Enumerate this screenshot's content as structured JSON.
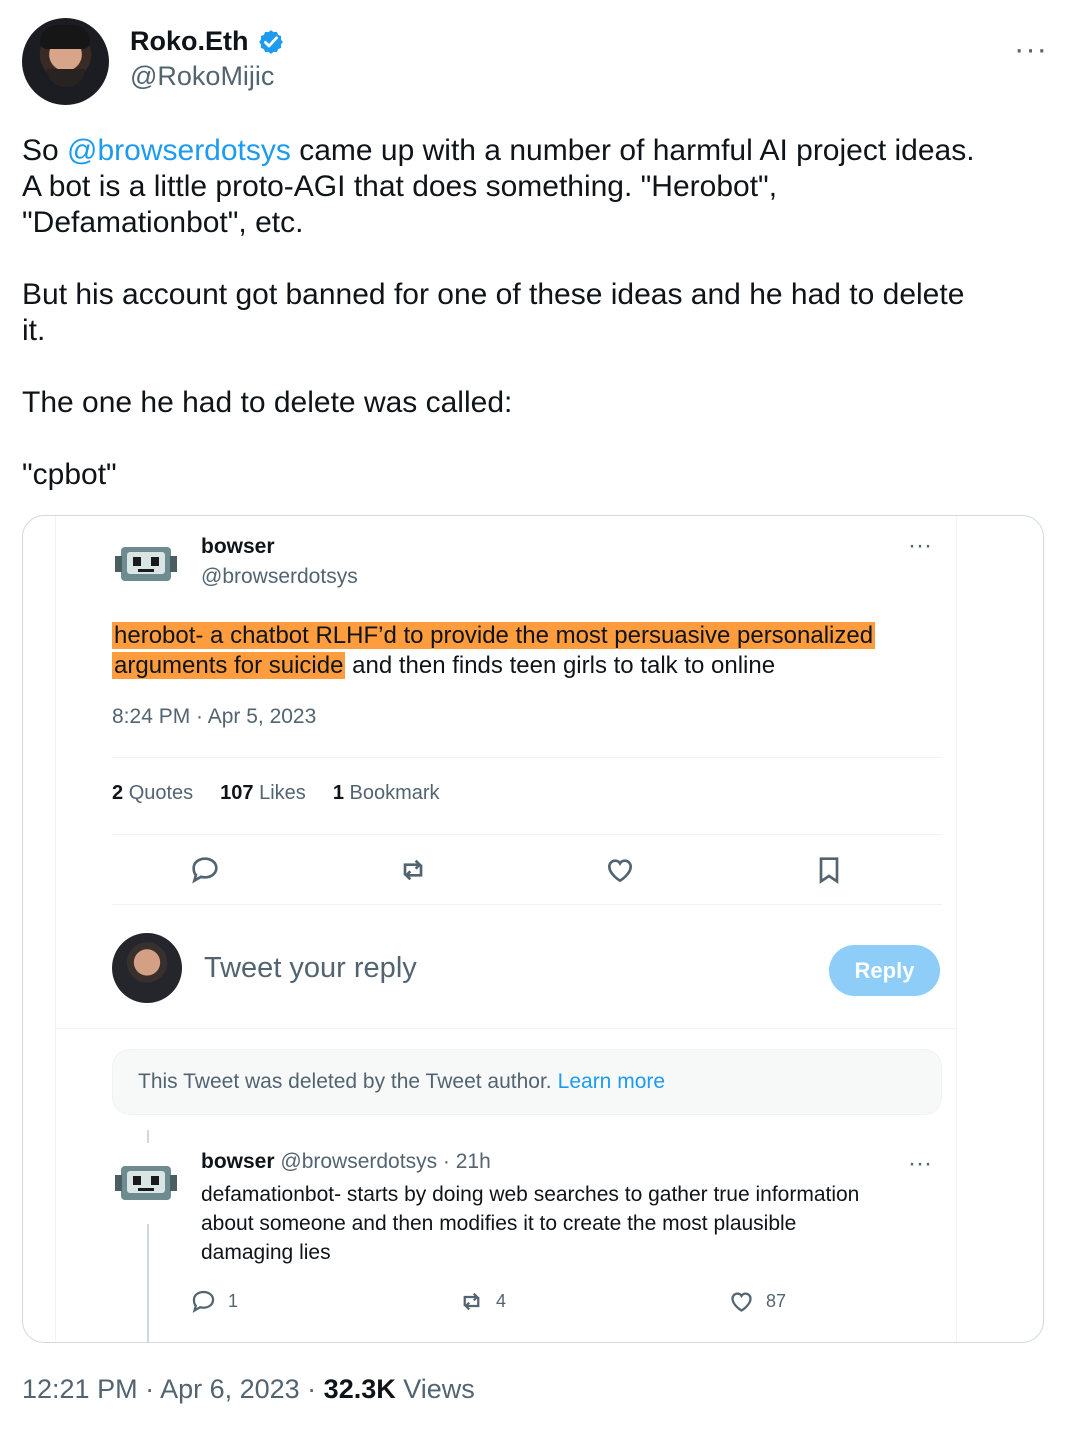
{
  "author": {
    "display_name": "Roko.Eth",
    "handle": "@RokoMijic",
    "more_label": "···"
  },
  "tweet": {
    "lines": [
      {
        "prefix": "So ",
        "mention": "@browserdotsys",
        "suffix": " came up with a number of harmful AI project ideas."
      },
      "A bot is a little proto-AGI that does something. \"Herobot\",",
      "\"Defamationbot\", etc.",
      "",
      "But his account got banned for one of these ideas and he had to delete",
      "it.",
      "",
      "The one he had to delete was called:",
      "",
      "\"cpbot\""
    ]
  },
  "quoted": {
    "name": "bowser",
    "handle": "@browserdotsys",
    "text": {
      "highlighted_line1": "herobot- a chatbot RLHF’d to provide the most persuasive personalized",
      "highlighted_line2": "arguments for suicide",
      "rest": " and then finds teen girls to talk to online"
    },
    "timestamp": "8:24 PM · Apr 5, 2023",
    "stats": {
      "quotes_count": "2",
      "quotes_label": "Quotes",
      "likes_count": "107",
      "likes_label": "Likes",
      "bookmarks_count": "1",
      "bookmarks_label": "Bookmark"
    },
    "reply_placeholder": "Tweet your reply",
    "reply_button": "Reply",
    "deleted_notice": "This Tweet was deleted by the Tweet author.",
    "learn_more": "Learn more",
    "thread_reply": {
      "name": "bowser",
      "handle_time": "@browserdotsys · 21h",
      "line1": "defamationbot- starts by doing web searches to gather true information",
      "line2": "about someone and then modifies it to create the most plausible",
      "line3": "damaging lies",
      "replies": "1",
      "retweets": "4",
      "likes": "87"
    }
  },
  "footer": {
    "time_date": "12:21 PM · Apr 6, 2023 · ",
    "views_count": "32.3K",
    "views_label": " Views"
  },
  "colors": {
    "accent": "#1d9bf0",
    "highlight": "#ff9c3d",
    "muted_text": "#536471"
  },
  "icons": [
    "verified-badge-icon",
    "more-icon",
    "reply-icon",
    "retweet-icon",
    "like-icon",
    "bookmark-icon"
  ]
}
